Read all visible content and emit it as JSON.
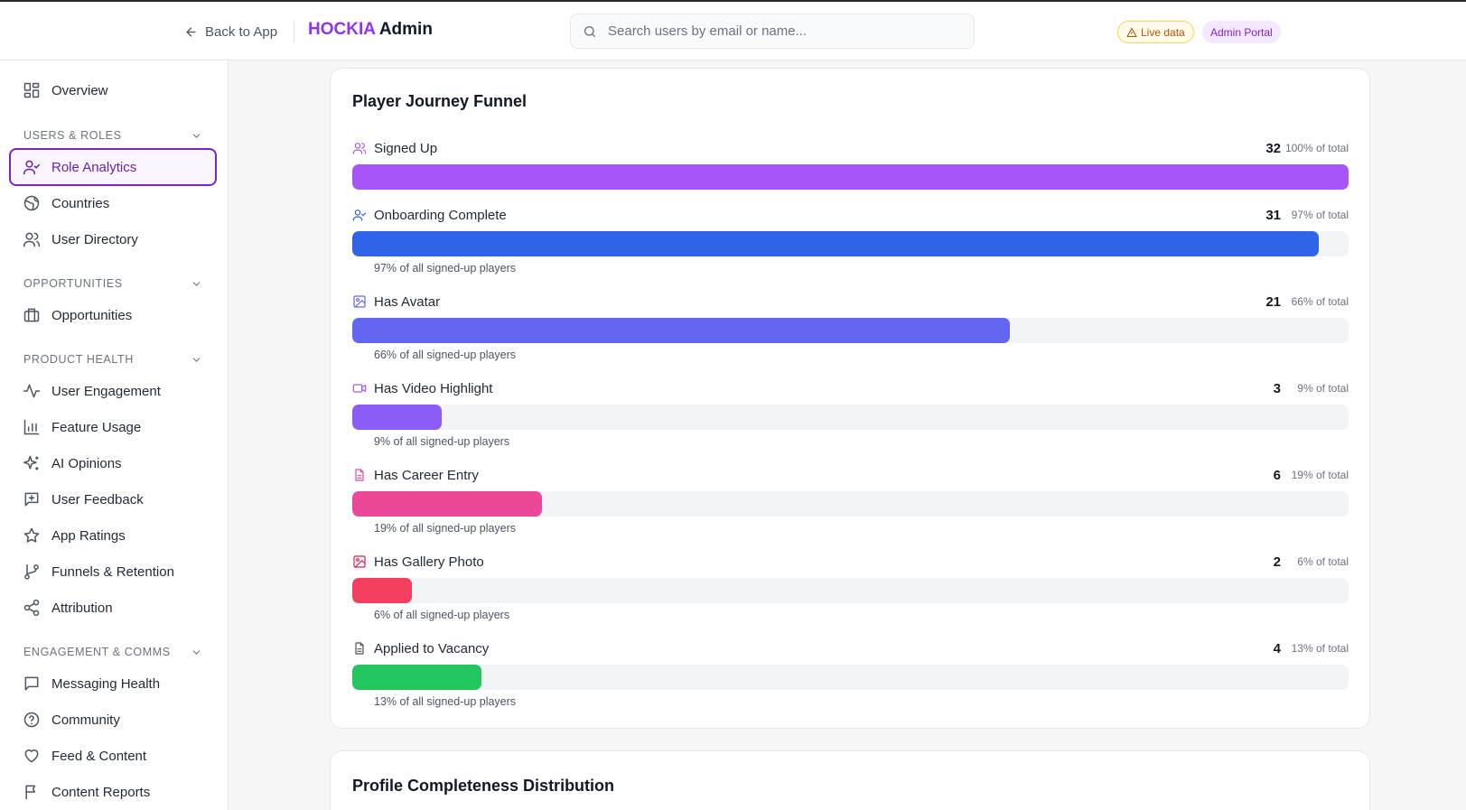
{
  "header": {
    "back_label": "Back to App",
    "brand_name": "HOCKIA",
    "brand_suffix": "Admin",
    "search_placeholder": "Search users by email or name...",
    "live_badge": "Live data",
    "portal_badge": "Admin Portal"
  },
  "sidebar": {
    "overview": "Overview",
    "sections": [
      {
        "title": "USERS & ROLES",
        "items": [
          "Role Analytics",
          "Countries",
          "User Directory"
        ]
      },
      {
        "title": "OPPORTUNITIES",
        "items": [
          "Opportunities"
        ]
      },
      {
        "title": "PRODUCT HEALTH",
        "items": [
          "User Engagement",
          "Feature Usage",
          "AI Opinions",
          "User Feedback",
          "App Ratings",
          "Funnels & Retention",
          "Attribution"
        ]
      },
      {
        "title": "ENGAGEMENT & COMMS",
        "items": [
          "Messaging Health",
          "Community",
          "Feed & Content",
          "Content Reports"
        ]
      }
    ],
    "active_item": "Role Analytics"
  },
  "funnel": {
    "title": "Player Journey Funnel",
    "stages": [
      {
        "label": "Signed Up",
        "count": "32",
        "pct_label": "100% of total",
        "value": 100,
        "color": "#a855f7",
        "icon_color": "#a855f7",
        "note": ""
      },
      {
        "label": "Onboarding Complete",
        "count": "31",
        "pct_label": "97% of total",
        "value": 97,
        "color": "#2f63e8",
        "icon_color": "#2f63e8",
        "note": "97% of all signed-up players"
      },
      {
        "label": "Has Avatar",
        "count": "21",
        "pct_label": "66% of total",
        "value": 66,
        "color": "#6366f1",
        "icon_color": "#6366f1",
        "note": "66% of all signed-up players"
      },
      {
        "label": "Has Video Highlight",
        "count": "3",
        "pct_label": "9% of total",
        "value": 9,
        "color": "#8b5cf6",
        "icon_color": "#a855f7",
        "note": "9% of all signed-up players"
      },
      {
        "label": "Has Career Entry",
        "count": "6",
        "pct_label": "19% of total",
        "value": 19,
        "color": "#ec4899",
        "icon_color": "#ec4899",
        "note": "19% of all signed-up players"
      },
      {
        "label": "Has Gallery Photo",
        "count": "2",
        "pct_label": "6% of total",
        "value": 6,
        "color": "#f43f5e",
        "icon_color": "#e11d48",
        "note": "6% of all signed-up players"
      },
      {
        "label": "Applied to Vacancy",
        "count": "4",
        "pct_label": "13% of total",
        "value": 13,
        "color": "#22c55e",
        "icon_color": "#4b5563",
        "note": "13% of all signed-up players"
      }
    ]
  },
  "distribution": {
    "title": "Profile Completeness Distribution"
  }
}
